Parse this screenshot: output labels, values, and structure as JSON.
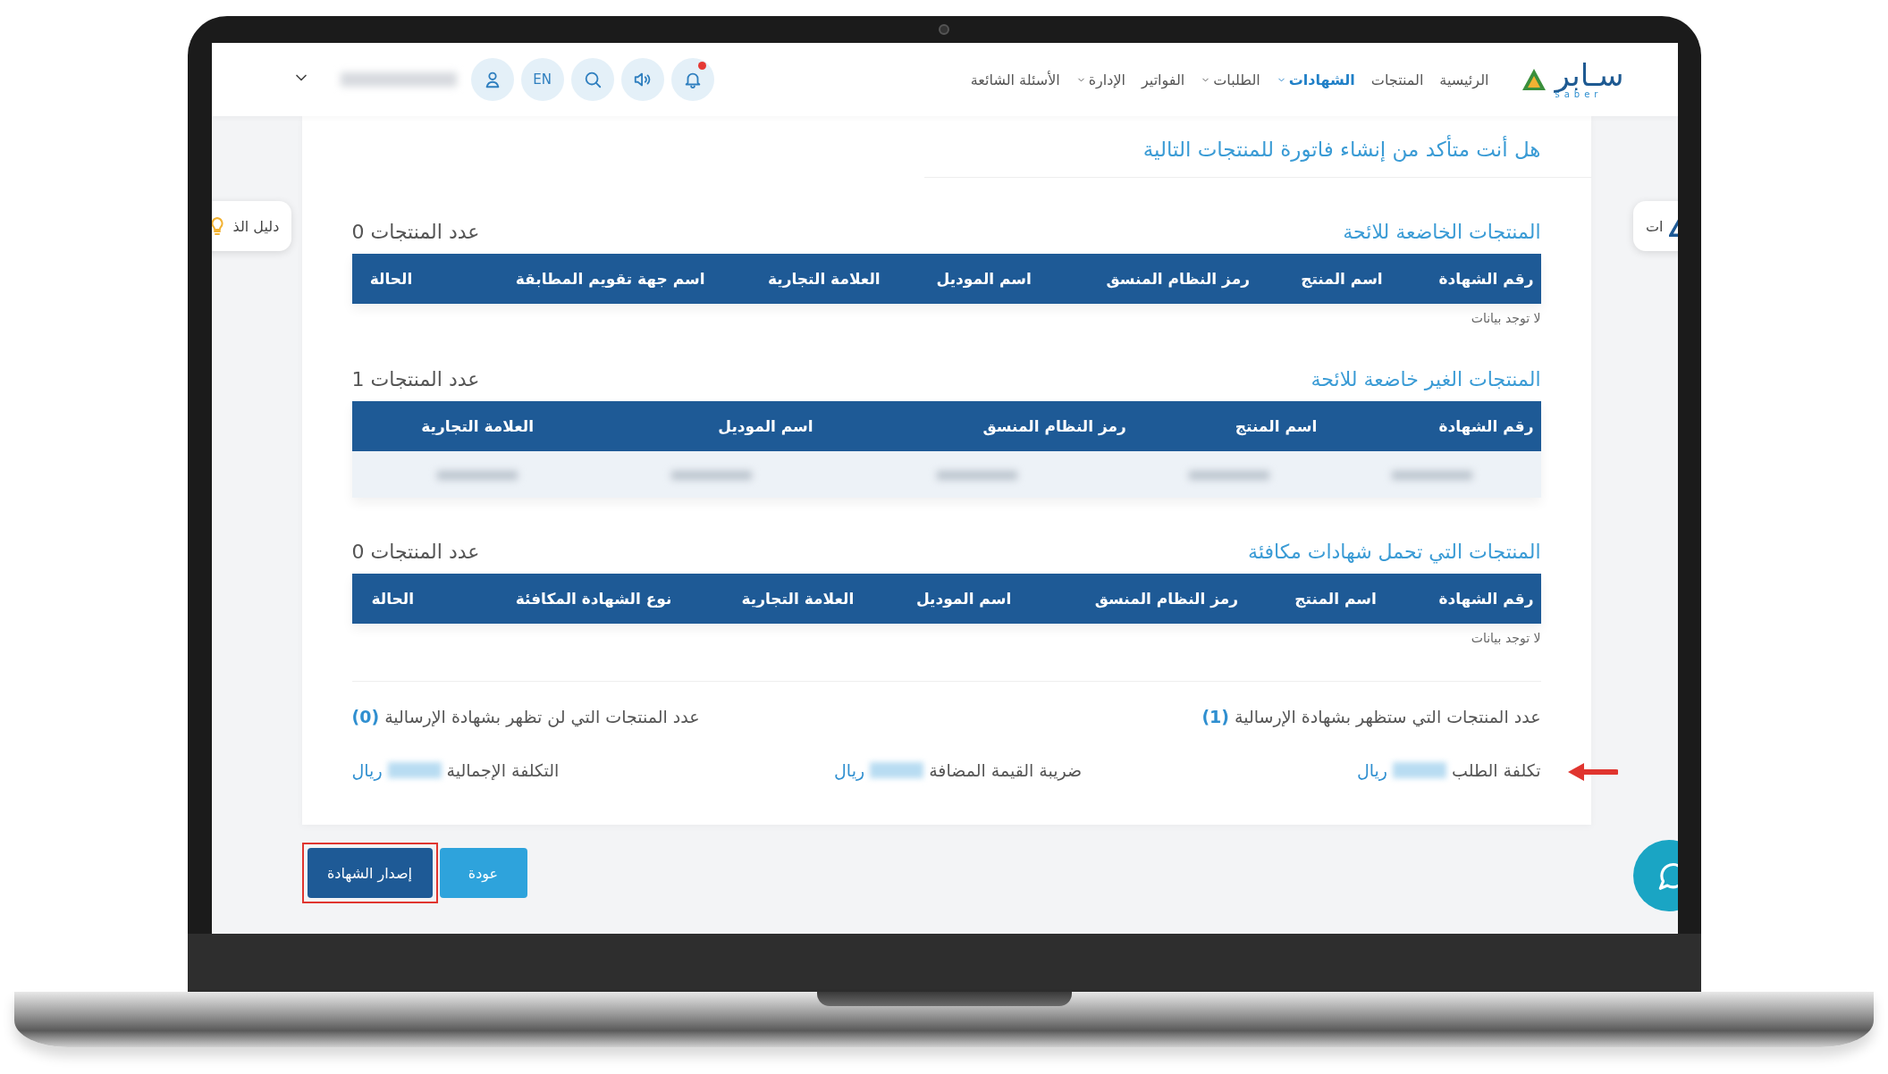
{
  "nav": {
    "logo": "سـابر",
    "logo_sub": "saber",
    "items": [
      {
        "label": "الرئيسية",
        "selected": false,
        "dropdown": false
      },
      {
        "label": "المنتجات",
        "selected": false,
        "dropdown": false
      },
      {
        "label": "الشهادات",
        "selected": true,
        "dropdown": true
      },
      {
        "label": "الطلبات",
        "selected": false,
        "dropdown": true
      },
      {
        "label": "الفواتير",
        "selected": false,
        "dropdown": false
      },
      {
        "label": "الإدارة",
        "selected": false,
        "dropdown": true
      },
      {
        "label": "الأسئلة الشائعة",
        "selected": false,
        "dropdown": false
      }
    ],
    "notification_dot": true,
    "language": "EN"
  },
  "side_tabs": {
    "left": "دليل الذ",
    "right": "ات"
  },
  "title": "هل أنت متأكد من إنشاء فاتورة للمنتجات التالية",
  "sections": [
    {
      "title": "المنتجات الخاضعة للائحة",
      "count": "عدد المنتجات 0",
      "columns": [
        "رقم الشهادة",
        "اسم المنتج",
        "رمز النظام المنسق",
        "اسم الموديل",
        "العلامة التجارية",
        "اسم جهة تقويم المطابقة",
        "الحالة"
      ],
      "empty_text": "لا توجد بيانات"
    },
    {
      "title": "المنتجات الغير خاضعة للائحة",
      "count": "عدد المنتجات 1",
      "columns": [
        "رقم الشهادة",
        "اسم المنتج",
        "رمز النظام المنسق",
        "اسم الموديل",
        "العلامة التجارية"
      ],
      "rows": [
        {
          "kind": "blurred"
        }
      ]
    },
    {
      "title": "المنتجات التي تحمل شهادات مكافئة",
      "count": "عدد المنتجات 0",
      "columns": [
        "رقم الشهادة",
        "اسم المنتج",
        "رمز النظام المنسق",
        "اسم الموديل",
        "العلامة التجارية",
        "نوع الشهادة المكافئة",
        "الحالة"
      ],
      "empty_text": "لا توجد بيانات"
    }
  ],
  "summary": [
    {
      "label": "عدد المنتجات التي ستظهر بشهادة الإرسالية",
      "value": "(1)"
    },
    {
      "label": "عدد المنتجات التي لن تظهر بشهادة الإرسالية",
      "value": "(0)"
    }
  ],
  "costs": [
    {
      "label": "تكلفة الطلب",
      "currency": "ريال",
      "pointed": true
    },
    {
      "label": "ضريبة القيمة المضافة",
      "currency": "ريال",
      "pointed": false
    },
    {
      "label": "التكلفة الإجمالية",
      "currency": "ريال",
      "pointed": false
    }
  ],
  "buttons": [
    {
      "label": "عودة",
      "kind": "secondary",
      "highlighted": false
    },
    {
      "label": "إصدار الشهادة",
      "kind": "primary",
      "highlighted": true
    }
  ]
}
